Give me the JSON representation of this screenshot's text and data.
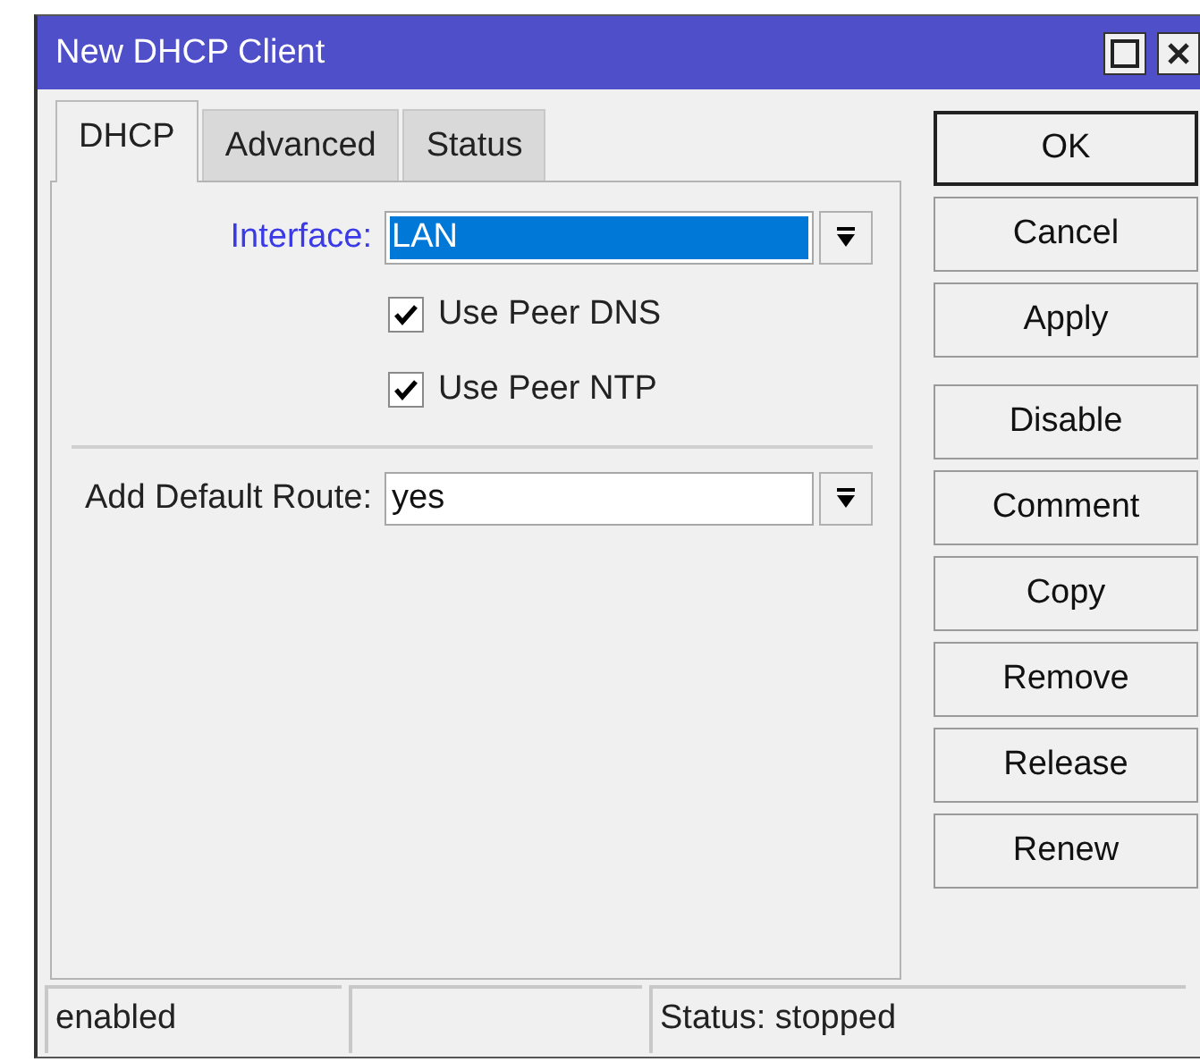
{
  "window": {
    "title": "New DHCP Client"
  },
  "tabs": [
    {
      "label": "DHCP",
      "selected": true
    },
    {
      "label": "Advanced",
      "selected": false
    },
    {
      "label": "Status",
      "selected": false
    }
  ],
  "interface": {
    "label": "Interface:",
    "value": "LAN",
    "selected": true
  },
  "checkboxes": [
    {
      "label": "Use Peer DNS",
      "checked": true
    },
    {
      "label": "Use Peer NTP",
      "checked": true
    }
  ],
  "add_default_route": {
    "label": "Add Default Route:",
    "value": "yes",
    "selected": false
  },
  "buttons": [
    {
      "label": "OK",
      "default": true
    },
    {
      "label": "Cancel",
      "default": false
    },
    {
      "label": "Apply",
      "default": false
    }
  ],
  "action_buttons": [
    {
      "label": "Disable",
      "default": false
    },
    {
      "label": "Comment",
      "default": false
    },
    {
      "label": "Copy",
      "default": false
    },
    {
      "label": "Remove",
      "default": false
    },
    {
      "label": "Release",
      "default": false
    },
    {
      "label": "Renew",
      "default": false
    }
  ],
  "status_bar": {
    "cell_1": "enabled",
    "cell_3": "Status: stopped"
  }
}
